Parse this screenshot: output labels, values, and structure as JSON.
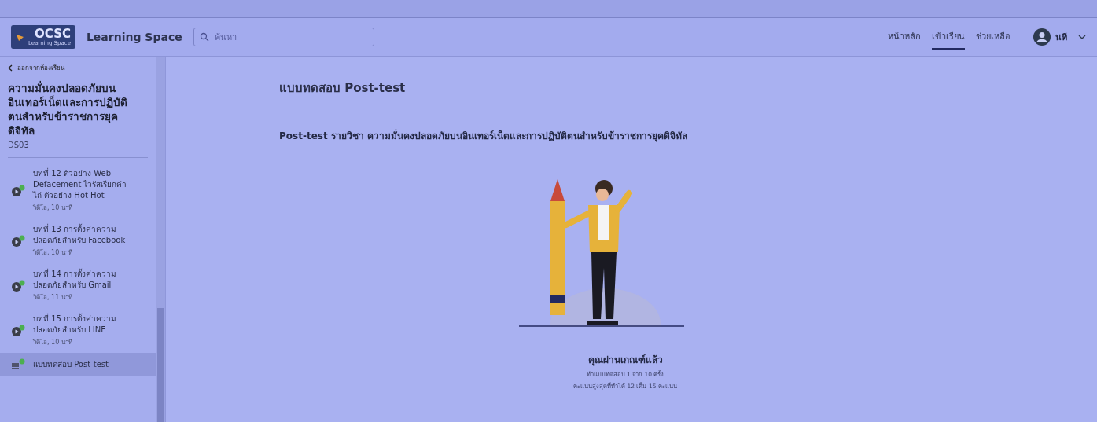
{
  "header": {
    "logo": {
      "text": "OCSC",
      "subtext": "Learning Space"
    },
    "app_name": "Learning Space",
    "search": {
      "placeholder": "ค้นหา"
    },
    "nav": [
      {
        "label": "หน้าหลัก",
        "selected": false
      },
      {
        "label": "เข้าเรียน",
        "selected": true
      },
      {
        "label": "ช่วยเหลือ",
        "selected": false
      }
    ],
    "user": {
      "name": "นที"
    }
  },
  "sidebar": {
    "back_link": "ออกจากห้องเรียน",
    "course_title": "ความมั่นคงปลอดภัยบนอินเทอร์เน็ตและการปฏิบัติตนสำหรับข้าราชการยุคดิจิทัล",
    "course_code": "DS03",
    "items": [
      {
        "kind": "video",
        "title": "บทที่ 12 ตัวอย่าง Web Defacement ไวรัสเรียกค่าไถ่ ตัวอย่าง Hot Hot",
        "meta": "วิดีโอ, 10 นาที",
        "done": true,
        "selected": false
      },
      {
        "kind": "video",
        "title": "บทที่ 13 การตั้งค่าความปลอดภัยสำหรับ Facebook",
        "meta": "วิดีโอ, 10 นาที",
        "done": true,
        "selected": false
      },
      {
        "kind": "video",
        "title": "บทที่ 14 การตั้งค่าความปลอดภัยสำหรับ Gmail",
        "meta": "วิดีโอ, 11 นาที",
        "done": true,
        "selected": false
      },
      {
        "kind": "video",
        "title": "บทที่ 15 การตั้งค่าความปลอดภัยสำหรับ LINE",
        "meta": "วิดีโอ, 10 นาที",
        "done": true,
        "selected": false
      },
      {
        "kind": "quiz",
        "title": "แบบทดสอบ Post-test",
        "done": true,
        "selected": true
      }
    ]
  },
  "main": {
    "heading": "แบบทดสอบ Post-test",
    "description": "Post-test รายวิชา ความมั่นคงปลอดภัยบนอินเทอร์เน็ตและการปฏิบัติตนสำหรับข้าราชการยุคดิจิทัล",
    "result": {
      "title": "คุณผ่านเกณฑ์แล้ว",
      "attempts": "ทำแบบทดสอบ 1 จาก 10 ครั้ง",
      "score": "คะแนนสูงสุดที่ทำได้ 12 เต็ม 15 คะแนน"
    }
  }
}
